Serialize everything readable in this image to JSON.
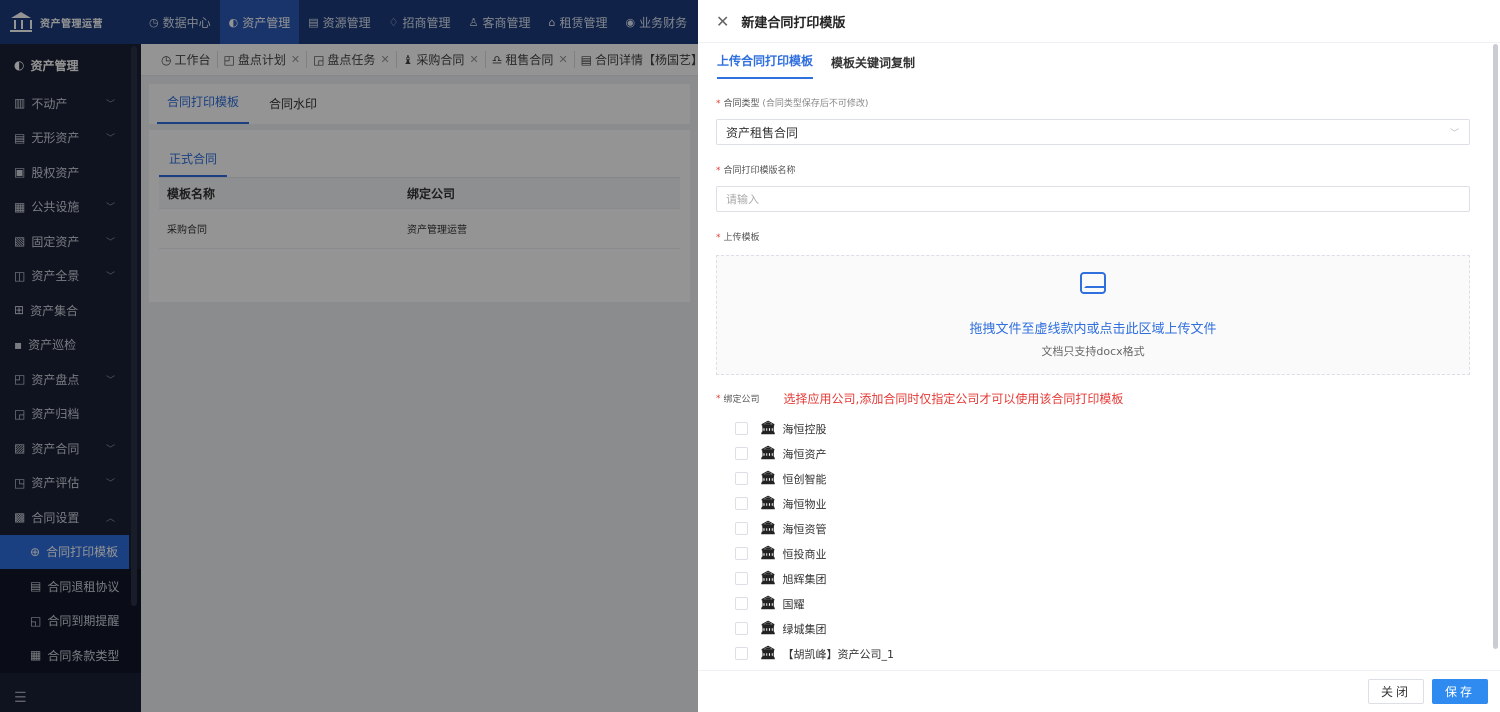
{
  "app": {
    "name": "资产管理运营"
  },
  "topnav": [
    {
      "icon": "◷",
      "label": "数据中心"
    },
    {
      "icon": "◐",
      "label": "资产管理"
    },
    {
      "icon": "▤",
      "label": "资源管理"
    },
    {
      "icon": "♢",
      "label": "招商管理"
    },
    {
      "icon": "♙",
      "label": "客商管理"
    },
    {
      "icon": "⌂",
      "label": "租赁管理"
    },
    {
      "icon": "◉",
      "label": "业务财务"
    }
  ],
  "sidebar": {
    "title": "资产管理",
    "items": [
      {
        "icon": "▥",
        "label": "不动产",
        "chevron": "﹀"
      },
      {
        "icon": "▤",
        "label": "无形资产",
        "chevron": "﹀"
      },
      {
        "icon": "▣",
        "label": "股权资产",
        "chevron": ""
      },
      {
        "icon": "▦",
        "label": "公共设施",
        "chevron": "﹀"
      },
      {
        "icon": "▧",
        "label": "固定资产",
        "chevron": "﹀"
      },
      {
        "icon": "◫",
        "label": "资产全景",
        "chevron": "﹀"
      },
      {
        "icon": "⊞",
        "label": "资产集合",
        "chevron": ""
      },
      {
        "icon": "▪",
        "label": "资产巡检",
        "chevron": ""
      },
      {
        "icon": "◰",
        "label": "资产盘点",
        "chevron": "﹀"
      },
      {
        "icon": "◲",
        "label": "资产归档",
        "chevron": ""
      },
      {
        "icon": "▨",
        "label": "资产合同",
        "chevron": "﹀"
      },
      {
        "icon": "◳",
        "label": "资产评估",
        "chevron": "﹀"
      },
      {
        "icon": "▩",
        "label": "合同设置",
        "chevron": "︿"
      }
    ],
    "subitems": [
      {
        "icon": "⊕",
        "label": "合同打印模板"
      },
      {
        "icon": "▤",
        "label": "合同退租协议"
      },
      {
        "icon": "◱",
        "label": "合同到期提醒"
      },
      {
        "icon": "▦",
        "label": "合同条款类型"
      }
    ],
    "foot_icon": "☰"
  },
  "tabs": [
    {
      "icon": "◷",
      "label": "工作台",
      "closable": false
    },
    {
      "icon": "◰",
      "label": "盘点计划",
      "closable": true
    },
    {
      "icon": "◲",
      "label": "盘点任务",
      "closable": true
    },
    {
      "icon": "♝",
      "label": "采购合同",
      "closable": true
    },
    {
      "icon": "♎",
      "label": "租售合同",
      "closable": true
    },
    {
      "icon": "▤",
      "label": "合同详情【杨国艺】",
      "closable": false
    }
  ],
  "page": {
    "subtabs": [
      "合同打印模板",
      "合同水印"
    ],
    "inner_tab": "正式合同",
    "columns": [
      "模板名称",
      "绑定公司"
    ],
    "rows": [
      [
        "采购合同",
        "资产管理运营"
      ]
    ]
  },
  "drawer": {
    "title": "新建合同打印模版",
    "tabs": [
      "上传合同打印模板",
      "模板关键词复制"
    ],
    "type_label": "合同类型",
    "type_hint": "(合同类型保存后不可修改)",
    "type_value": "资产租售合同",
    "name_label": "合同打印模版名称",
    "name_placeholder": "请输入",
    "upload_label": "上传模板",
    "upload_main": "拖拽文件至虚线款内或点击此区域上传文件",
    "upload_sub": "文档只支持docx格式",
    "company_label": "绑定公司",
    "company_warning": "选择应用公司,添加合同时仅指定公司才可以使用该合同打印模板",
    "companies": [
      "海恒控股",
      "海恒资产",
      "恒创智能",
      "海恒物业",
      "海恒资管",
      "恒投商业",
      "旭辉集团",
      "国耀",
      "绿城集团",
      "【胡凯峰】资产公司_1"
    ],
    "close_btn": "关闭",
    "save_btn": "保存"
  }
}
